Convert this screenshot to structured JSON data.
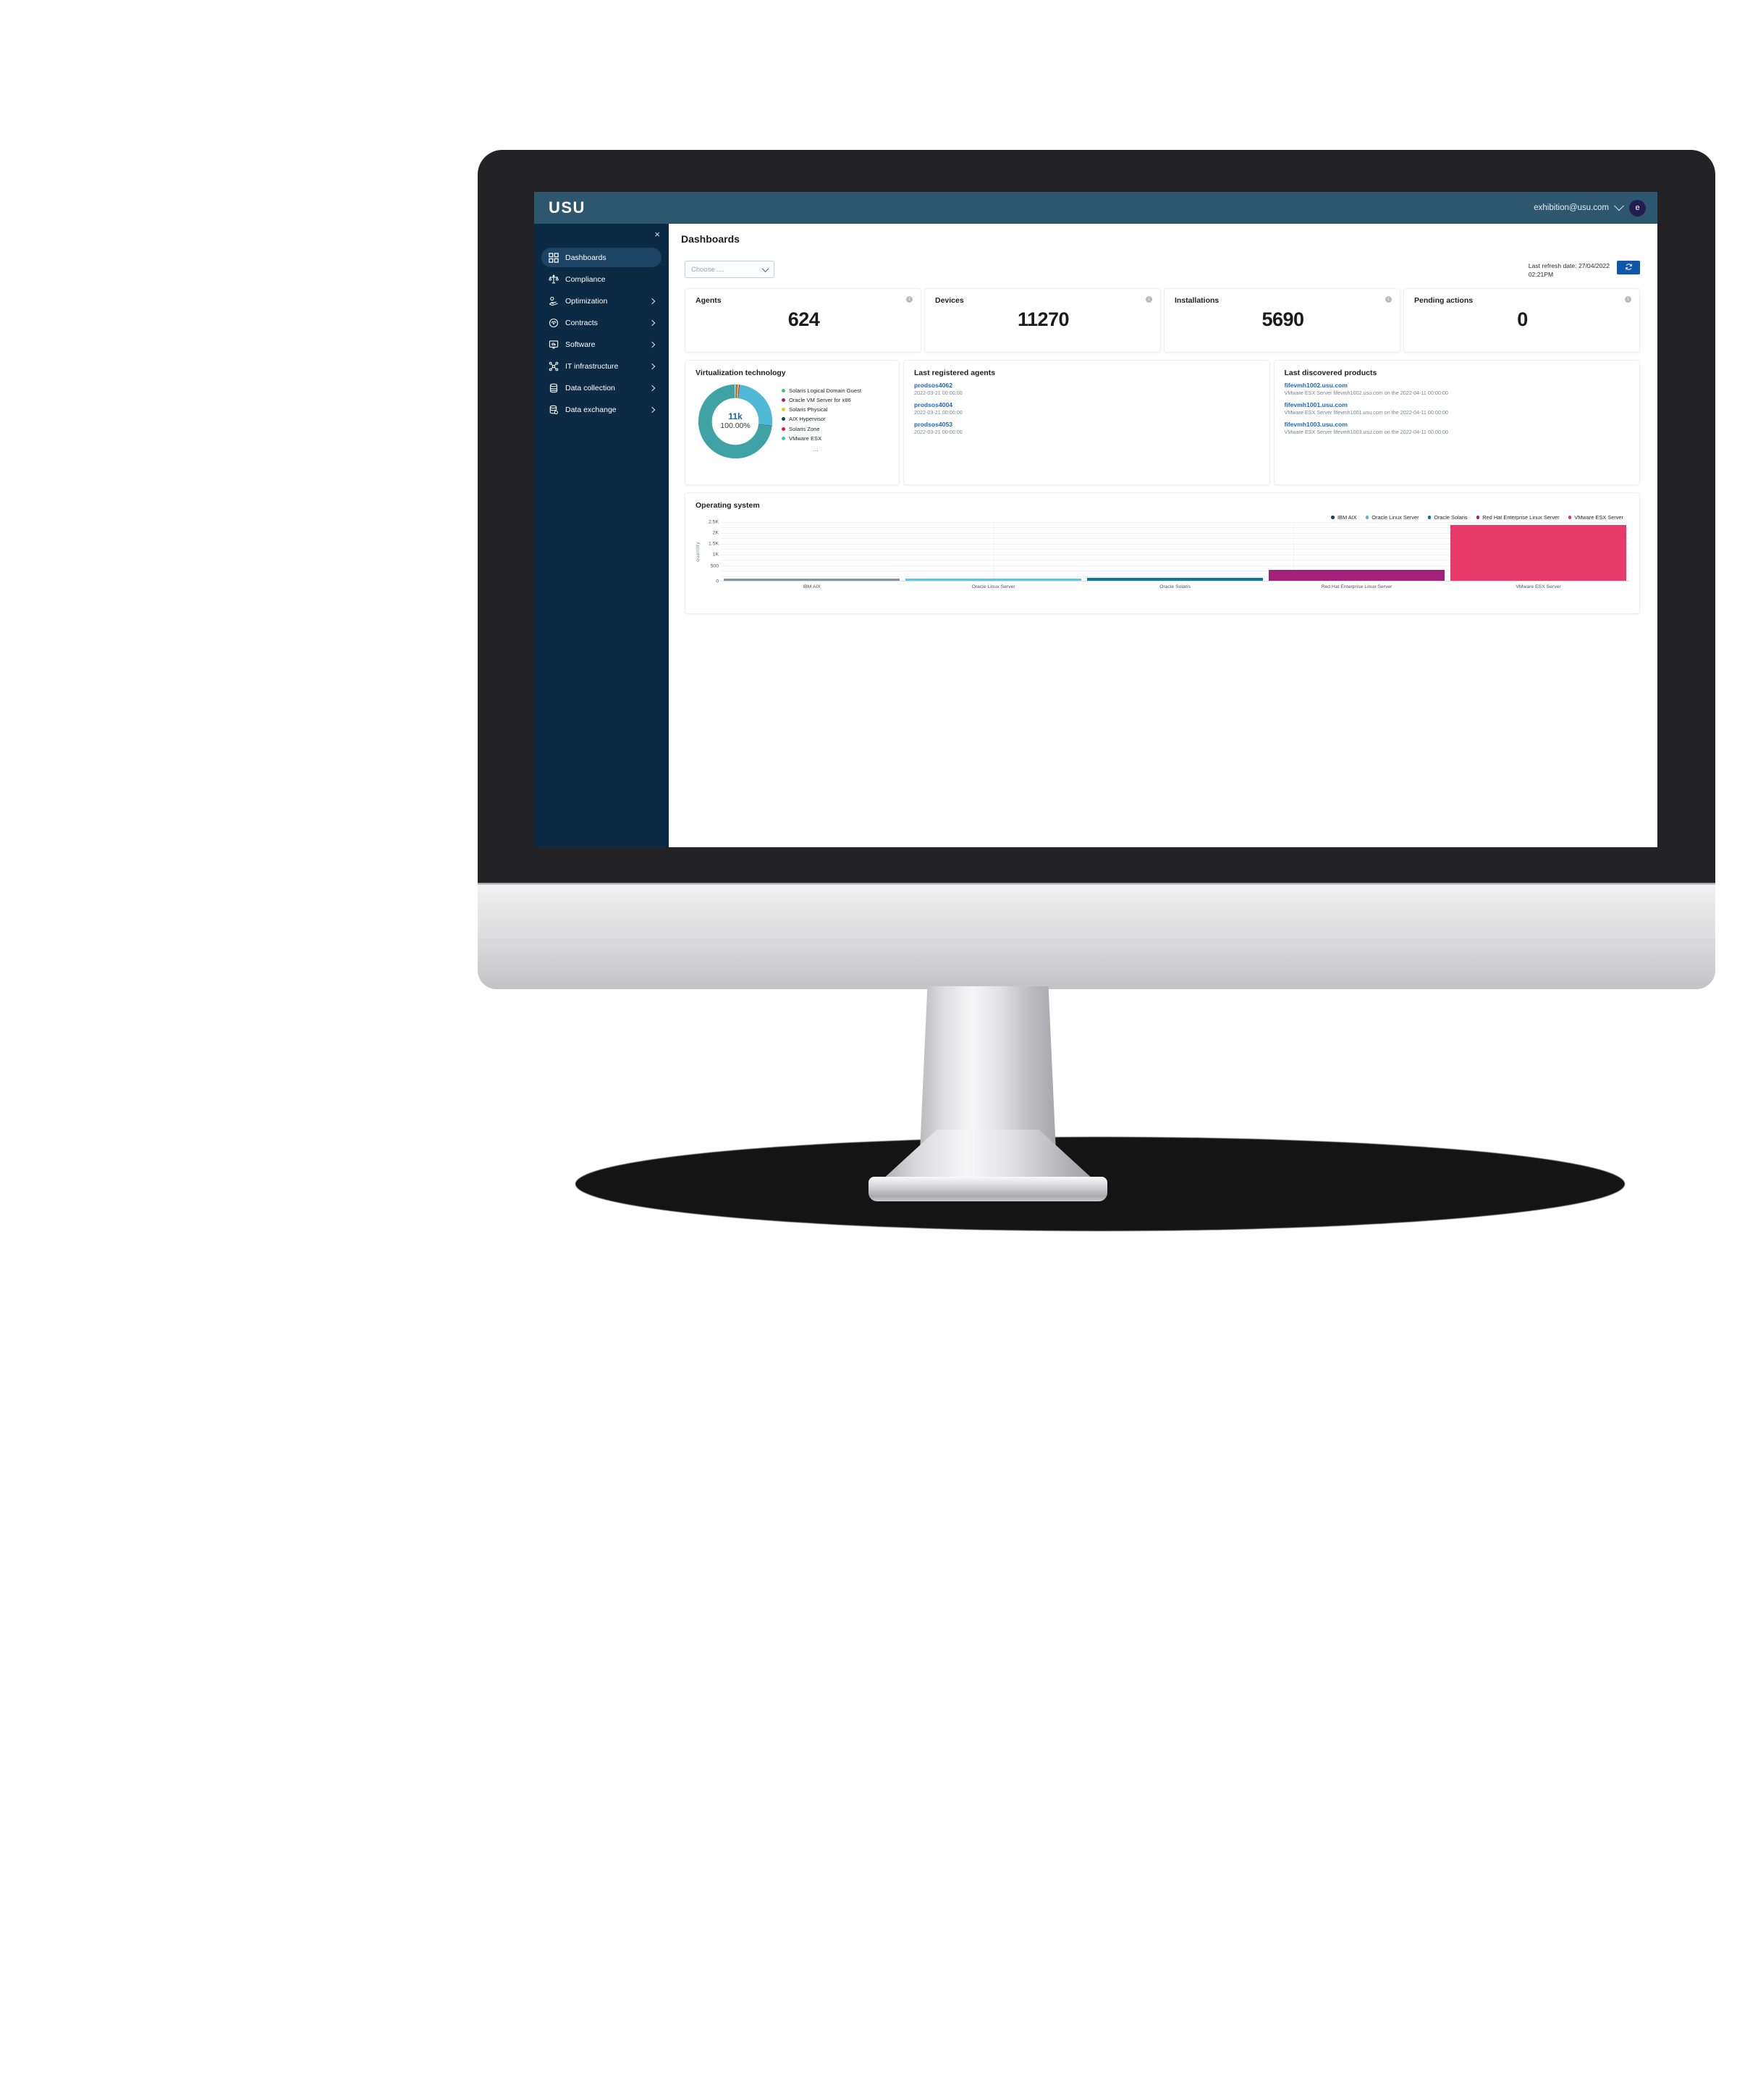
{
  "topbar": {
    "logo": "USU",
    "user_email": "exhibition@usu.com",
    "avatar_initial": "e",
    "bg_color": "#2d566f"
  },
  "sidebar": {
    "close_label": "×",
    "bg_color": "#0c2a44",
    "active_bg_color": "#1b4465",
    "items": [
      {
        "label": "Dashboards",
        "icon": "grid-icon",
        "active": true,
        "has_chevron": false
      },
      {
        "label": "Compliance",
        "icon": "scales-icon",
        "active": false,
        "has_chevron": false
      },
      {
        "label": "Optimization",
        "icon": "hand-coin-icon",
        "active": false,
        "has_chevron": true
      },
      {
        "label": "Contracts",
        "icon": "handshake-icon",
        "active": false,
        "has_chevron": true
      },
      {
        "label": "Software",
        "icon": "monitor-cloud-icon",
        "active": false,
        "has_chevron": true
      },
      {
        "label": "IT infrastructure",
        "icon": "network-icon",
        "active": false,
        "has_chevron": true
      },
      {
        "label": "Data collection",
        "icon": "database-icon",
        "active": false,
        "has_chevron": true
      },
      {
        "label": "Data exchange",
        "icon": "database-sync-icon",
        "active": false,
        "has_chevron": true
      }
    ]
  },
  "page": {
    "title": "Dashboards"
  },
  "toolbar": {
    "select_placeholder": "Choose ....",
    "refresh_label_line1": "Last refresh date: 27/04/2022",
    "refresh_label_line2": "02:21PM",
    "refresh_button_icon": "refresh-icon",
    "refresh_button_color": "#0f57a8"
  },
  "kpis": [
    {
      "title": "Agents",
      "value": "624",
      "info_icon": "info-icon"
    },
    {
      "title": "Devices",
      "value": "11270",
      "info_icon": "info-icon"
    },
    {
      "title": "Installations",
      "value": "5690",
      "info_icon": "info-icon"
    },
    {
      "title": "Pending actions",
      "value": "0",
      "info_icon": "info-icon"
    }
  ],
  "virtualization": {
    "title": "Virtualization technology",
    "center_total": "11k",
    "center_percent": "100.00%",
    "more_label": "…",
    "legend": [
      {
        "label": "Solaris Logical Domain Guest",
        "color": "#4bbf73"
      },
      {
        "label": "Oracle VM Server for x86",
        "color": "#a81e73"
      },
      {
        "label": "Solaris Physical",
        "color": "#f5c21b"
      },
      {
        "label": "AIX Hypervisor",
        "color": "#14436b"
      },
      {
        "label": "Solaris Zone",
        "color": "#e01b3c"
      },
      {
        "label": "VMware ESX",
        "color": "#4fb8d4"
      }
    ]
  },
  "last_registered_agents": {
    "title": "Last registered agents",
    "items": [
      {
        "name": "prodsos4062",
        "date": "2022-03-21 00:00:00"
      },
      {
        "name": "prodsos4004",
        "date": "2022-03-21 00:00:00"
      },
      {
        "name": "prodsos4053",
        "date": "2022-03-21 00:00:00"
      }
    ]
  },
  "last_discovered_products": {
    "title": "Last discovered products",
    "items": [
      {
        "name": "fifevmh1002.usu.com",
        "description": "VMware ESX Server fifevmh1002.usu.com on the 2022-04-11 00:00:00"
      },
      {
        "name": "fifevmh1001.usu.com",
        "description": "VMware ESX Server fifevmh1001.usu.com on the 2022-04-11 00:00:00"
      },
      {
        "name": "fifevmh1003.usu.com",
        "description": "VMware ESX Server fifevmh1003.usu.com on the 2022-04-11 00:00:00"
      }
    ]
  },
  "operating_system_panel": {
    "title": "Operating system"
  },
  "chart_data": {
    "type": "bar",
    "title": "Operating system",
    "xlabel": "",
    "ylabel": "quantity",
    "ylim": [
      0,
      2700
    ],
    "yticks": [
      0,
      500,
      1000,
      1500,
      2000,
      2500
    ],
    "ytick_labels": [
      "0",
      "500",
      "1K",
      "1.5K",
      "2K",
      "2.5K"
    ],
    "grid": true,
    "legend_position": "top-right",
    "categories": [
      "IBM AIX",
      "Oracle Linux Server",
      "Oracle Solaris",
      "Red Hat Enterprise Linux Server",
      "VMware ESX Server"
    ],
    "values": [
      30,
      30,
      130,
      480,
      2550
    ],
    "colors": [
      "#7f95a8",
      "#5cc8e0",
      "#12788f",
      "#a32279",
      "#e8396b"
    ],
    "legend": [
      {
        "name": "IBM AIX",
        "color": "#14436b"
      },
      {
        "name": "Oracle Linux Server",
        "color": "#4fb8d4"
      },
      {
        "name": "Oracle Solaris",
        "color": "#12788f"
      },
      {
        "name": "Red Hat Enterprise Linux Server",
        "color": "#a32279"
      },
      {
        "name": "VMware ESX Server",
        "color": "#e8396b"
      }
    ]
  }
}
